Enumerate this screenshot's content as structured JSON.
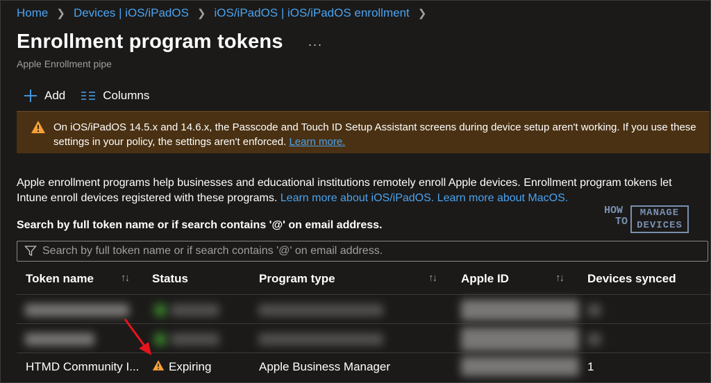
{
  "breadcrumb": {
    "items": [
      "Home",
      "Devices | iOS/iPadOS",
      "iOS/iPadOS | iOS/iPadOS enrollment"
    ],
    "separator": ">"
  },
  "page": {
    "title": "Enrollment program tokens",
    "more": "...",
    "subtitle": "Apple Enrollment pipe"
  },
  "toolbar": {
    "add_label": "Add",
    "columns_label": "Columns"
  },
  "banner": {
    "text": "On iOS/iPadOS 14.5.x and 14.6.x, the Passcode and Touch ID Setup Assistant screens during device setup aren't working. If you use these settings in your policy, the settings aren't enforced.",
    "link": "Learn more."
  },
  "description": {
    "line1": "Apple enrollment programs help businesses and educational institutions remotely enroll Apple devices. Enrollment program tokens let",
    "line2": "Intune enroll devices registered with these programs.",
    "link_ios": "Learn more about iOS/iPadOS.",
    "link_macos": "Learn more about MacOS."
  },
  "search": {
    "label": "Search by full token name or if search contains '@' on email address.",
    "placeholder": "Search by full token name or if search contains '@' on email address."
  },
  "table": {
    "columns": [
      "Token name",
      "Status",
      "Program type",
      "Apple ID",
      "Devices synced"
    ],
    "rows": [
      {
        "token_name": "",
        "status": "",
        "program_type": "",
        "apple_id": "",
        "devices_synced": ""
      },
      {
        "token_name": "",
        "status": "",
        "program_type": "",
        "apple_id": "",
        "devices_synced": ""
      },
      {
        "token_name": "HTMD Community I...",
        "status": "Expiring",
        "program_type": "Apple Business Manager",
        "apple_id": "",
        "devices_synced": "1"
      }
    ]
  },
  "watermark": {
    "how": "HOW",
    "to": "TO",
    "manage": "MANAGE",
    "devices": "DEVICES"
  },
  "colors": {
    "background": "#1b1a19",
    "accent": "#4aa3f0",
    "banner_bg": "#4a3113",
    "warning": "#f7a13a",
    "annotation_arrow": "#e8141c"
  },
  "icons": [
    "chevron-right-icon",
    "more-icon",
    "plus-icon",
    "columns-icon",
    "warning-icon",
    "filter-icon",
    "sort-icon",
    "annotation-arrow"
  ]
}
